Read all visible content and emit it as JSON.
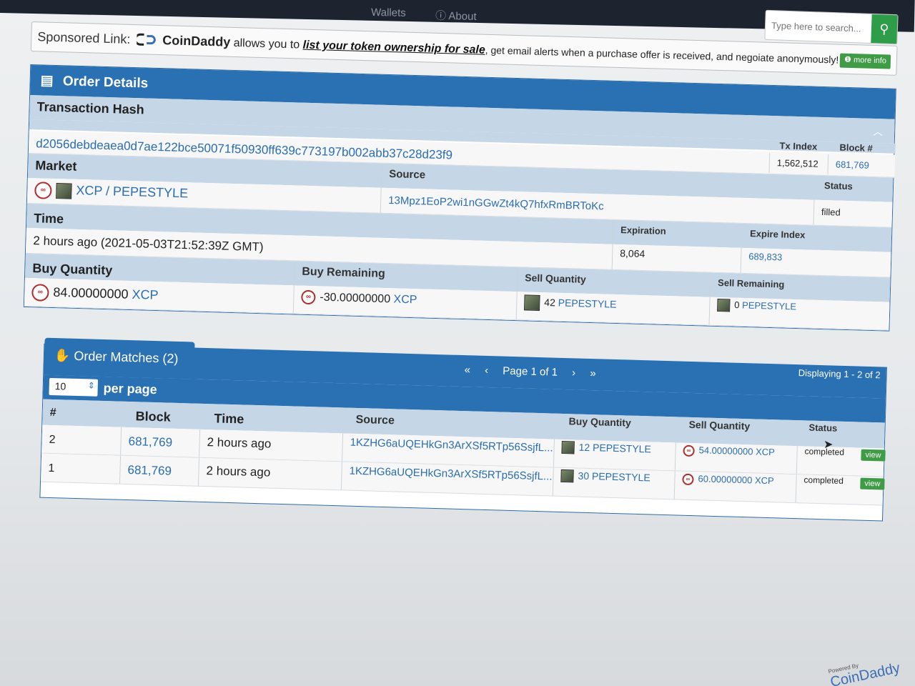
{
  "nav": {
    "items": [
      "Wallets",
      "About"
    ]
  },
  "search": {
    "placeholder": "Type here to search..."
  },
  "sponsor": {
    "label": "Sponsored Link:",
    "brand": "CoinDaddy",
    "text1": "allows you to",
    "link": "list your token ownership for sale",
    "text2": ", get email alerts when a purchase offer is received, and negoiate anonymously!",
    "more_info": "more info"
  },
  "order": {
    "title": "Order Details",
    "tx_hash_label": "Transaction Hash",
    "tx_hash": "d2056debdeaea0d7ae122bce50071f50930ff639c773197b002abb37c28d23f9",
    "tx_index_label": "Tx Index",
    "tx_index": "1,562,512",
    "block_label": "Block #",
    "block": "681,769",
    "market_label": "Market",
    "market": "XCP / PEPESTYLE",
    "source_label": "Source",
    "source": "13Mpz1EoP2wi1nGGwZt4kQ7hfxRmBRToKc",
    "status_label": "Status",
    "status": "filled",
    "time_label": "Time",
    "time": "2 hours ago (2021-05-03T21:52:39Z GMT)",
    "expiration_label": "Expiration",
    "expiration": "8,064",
    "expire_index_label": "Expire Index",
    "expire_index": "689,833",
    "buy_qty_label": "Buy Quantity",
    "buy_qty": "84.00000000",
    "buy_qty_asset": "XCP",
    "buy_rem_label": "Buy Remaining",
    "buy_rem": "-30.00000000",
    "buy_rem_asset": "XCP",
    "sell_qty_label": "Sell Quantity",
    "sell_qty": "42",
    "sell_qty_asset": "PEPESTYLE",
    "sell_rem_label": "Sell Remaining",
    "sell_rem": "0",
    "sell_rem_asset": "PEPESTYLE"
  },
  "matches": {
    "title": "Order Matches (2)",
    "pager": "Page 1 of 1",
    "displaying": "Displaying 1 - 2 of 2",
    "per_page_value": "10",
    "per_page_label": "per page",
    "columns": [
      "#",
      "Block",
      "Time",
      "Source",
      "Buy Quantity",
      "Sell Quantity",
      "Status"
    ],
    "rows": [
      {
        "num": "2",
        "block": "681,769",
        "time": "2 hours ago",
        "source": "1KZHG6aUQEHkGn3ArXSf5RTp56SsjfL...",
        "buy": "12 PEPESTYLE",
        "sell": "54.00000000 XCP",
        "status": "completed",
        "action": "view"
      },
      {
        "num": "1",
        "block": "681,769",
        "time": "2 hours ago",
        "source": "1KZHG6aUQEHkGn3ArXSf5RTp56SsjfL...",
        "buy": "30 PEPESTYLE",
        "sell": "60.00000000 XCP",
        "status": "completed",
        "action": "view"
      }
    ]
  },
  "footer": {
    "powered": "Powered By",
    "brand": "CoinDaddy"
  }
}
